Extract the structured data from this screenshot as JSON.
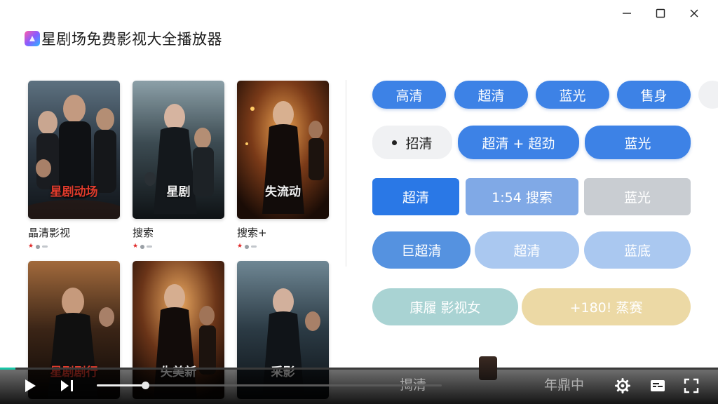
{
  "window": {
    "minimize_icon": "minimize-icon",
    "maximize_icon": "maximize-icon",
    "close_icon": "close-icon"
  },
  "app": {
    "title": "星剧场免费影视大全播放器"
  },
  "posters": [
    {
      "caption": "星剧动场",
      "title": "晶清影视"
    },
    {
      "caption": "星剧",
      "title": "搜索"
    },
    {
      "caption": "失流动",
      "title": "搜索+"
    },
    {
      "caption": "星剧剧行",
      "title": ""
    },
    {
      "caption": "失美新",
      "title": ""
    },
    {
      "caption": "采影",
      "title": ""
    }
  ],
  "chips": {
    "row1": [
      "高清",
      "超清",
      "蓝光",
      "售身"
    ],
    "row2": [
      "招清",
      "超清 + 超劲",
      "蓝光"
    ],
    "row3": [
      "超清",
      "1:54 搜索",
      "蓝光"
    ],
    "row4": [
      "巨超清",
      "超清",
      "蓝底"
    ],
    "row5": [
      "康履 影视女",
      "+180! 蒸赛"
    ]
  },
  "player": {
    "progress": 0.14,
    "ghost_left": "揭清",
    "ghost_mid": "年鼎中",
    "icons": [
      "play-icon",
      "next-icon",
      "settings-icon",
      "subtitles-icon",
      "fullscreen-icon"
    ]
  },
  "colors": {
    "accent": "#3d82e6",
    "progress": "#19c6a7"
  }
}
